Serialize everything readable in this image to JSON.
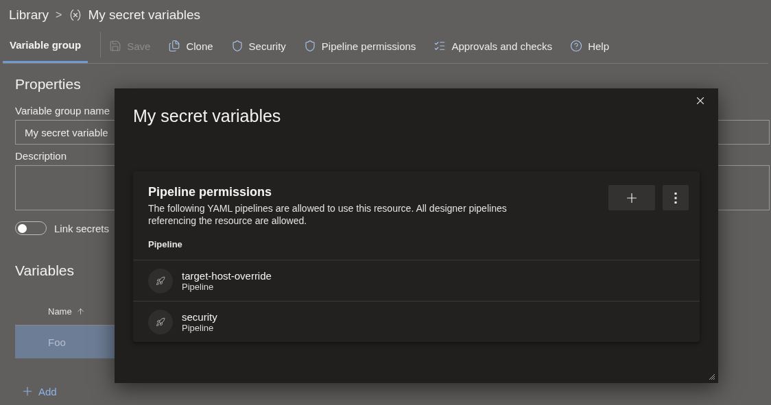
{
  "breadcrumb": {
    "root": "Library",
    "separator": ">",
    "title": "My secret variables"
  },
  "tabs": [
    {
      "label": "Variable group",
      "selected": true
    }
  ],
  "toolbar": [
    {
      "kind": "save",
      "label": "Save",
      "disabled": true
    },
    {
      "kind": "clone",
      "label": "Clone",
      "disabled": false
    },
    {
      "kind": "shield",
      "label": "Security",
      "disabled": false
    },
    {
      "kind": "shield",
      "label": "Pipeline permissions",
      "disabled": false
    },
    {
      "kind": "checklist",
      "label": "Approvals and checks",
      "disabled": false
    },
    {
      "kind": "help",
      "label": "Help",
      "disabled": false
    }
  ],
  "properties": {
    "heading": "Properties",
    "name_label": "Variable group name",
    "name_value": "My secret variable",
    "description_label": "Description",
    "link_secrets": {
      "label": "Link secrets",
      "on": false
    }
  },
  "variables": {
    "heading": "Variables",
    "column": "Name",
    "rows": [
      {
        "name": "Foo",
        "selected": true
      }
    ],
    "add": "Add"
  },
  "dialog": {
    "title": "My secret variables",
    "section": {
      "title": "Pipeline permissions",
      "description": "The following YAML pipelines are allowed to use this resource. All designer pipelines referencing the resource are allowed.",
      "column": "Pipeline",
      "rows": [
        {
          "name": "target-host-override",
          "type": "Pipeline"
        },
        {
          "name": "security",
          "type": "Pipeline"
        }
      ]
    }
  }
}
